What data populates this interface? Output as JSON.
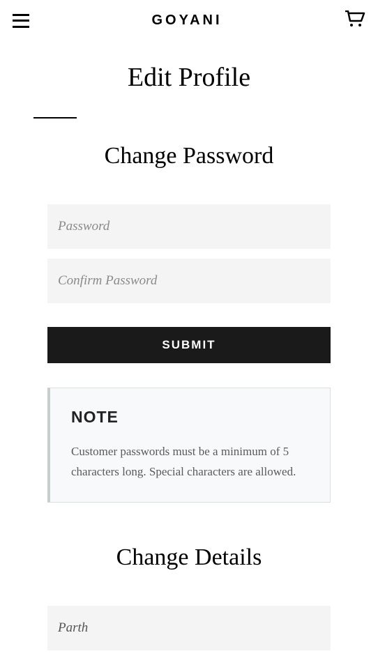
{
  "header": {
    "logo": "GOYANI"
  },
  "page": {
    "title": "Edit Profile"
  },
  "changePassword": {
    "title": "Change Password",
    "passwordPlaceholder": "Password",
    "confirmPlaceholder": "Confirm Password",
    "submitLabel": "SUBMIT"
  },
  "note": {
    "title": "NOTE",
    "text": "Customer passwords must be a minimum of 5 characters long. Special characters are allowed."
  },
  "changeDetails": {
    "title": "Change Details",
    "firstNameValue": "Parth"
  }
}
